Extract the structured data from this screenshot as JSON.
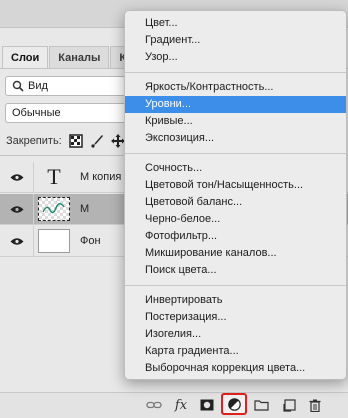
{
  "layers_panel": {
    "tabs": [
      "Слои",
      "Каналы",
      "К"
    ],
    "search_label": "Вид",
    "blend_mode": "Обычные",
    "lock_label": "Закрепить:",
    "layers": [
      {
        "name": "М копия",
        "type": "text",
        "selected": false
      },
      {
        "name": "М",
        "type": "image",
        "selected": true
      },
      {
        "name": "Фон",
        "type": "background",
        "selected": false
      }
    ],
    "bottom_fx": "fx"
  },
  "adjustment_menu": {
    "groups": [
      [
        "Цвет...",
        "Градиент...",
        "Узор..."
      ],
      [
        "Яркость/Контрастность...",
        "Уровни...",
        "Кривые...",
        "Экспозиция..."
      ],
      [
        "Сочность...",
        "Цветовой тон/Насыщенность...",
        "Цветовой баланс...",
        "Черно-белое...",
        "Фотофильтр...",
        "Микширование каналов...",
        "Поиск цвета..."
      ],
      [
        "Инвертировать",
        "Постеризация...",
        "Изогелия...",
        "Карта градиента...",
        "Выборочная коррекция цвета..."
      ]
    ],
    "highlighted": "Уровни..."
  },
  "colors": {
    "highlight": "#3d8ee8",
    "selected_layer": "#b3b3b3",
    "adjustment_button_outline": "#e02020"
  }
}
